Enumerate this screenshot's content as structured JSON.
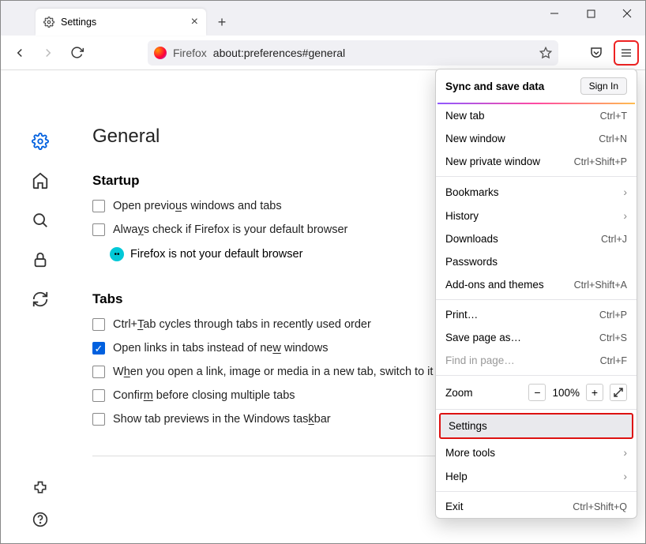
{
  "window": {
    "tab_title": "Settings",
    "url_label": "Firefox",
    "url": "about:preferences#general"
  },
  "page": {
    "heading": "General",
    "startup": {
      "title": "Startup",
      "open_previous": "Open previous windows and tabs",
      "always_check": "Always check if Firefox is your default browser",
      "not_default": "Firefox is not your default browser"
    },
    "tabs": {
      "title": "Tabs",
      "ctrl_tab": "Ctrl+Tab cycles through tabs in recently used order",
      "open_links": "Open links in tabs instead of new windows",
      "switch_to": "When you open a link, image or media in a new tab, switch to it",
      "confirm": "Confirm before closing multiple tabs",
      "taskbar": "Show tab previews in the Windows taskbar"
    }
  },
  "menu": {
    "sync": "Sync and save data",
    "signin": "Sign In",
    "new_tab": {
      "label": "New tab",
      "shortcut": "Ctrl+T"
    },
    "new_window": {
      "label": "New window",
      "shortcut": "Ctrl+N"
    },
    "new_private": {
      "label": "New private window",
      "shortcut": "Ctrl+Shift+P"
    },
    "bookmarks": "Bookmarks",
    "history": "History",
    "downloads": {
      "label": "Downloads",
      "shortcut": "Ctrl+J"
    },
    "passwords": "Passwords",
    "addons": {
      "label": "Add-ons and themes",
      "shortcut": "Ctrl+Shift+A"
    },
    "print": {
      "label": "Print…",
      "shortcut": "Ctrl+P"
    },
    "save": {
      "label": "Save page as…",
      "shortcut": "Ctrl+S"
    },
    "find": {
      "label": "Find in page…",
      "shortcut": "Ctrl+F"
    },
    "zoom": {
      "label": "Zoom",
      "value": "100%"
    },
    "settings": "Settings",
    "more_tools": "More tools",
    "help": "Help",
    "exit": {
      "label": "Exit",
      "shortcut": "Ctrl+Shift+Q"
    }
  }
}
